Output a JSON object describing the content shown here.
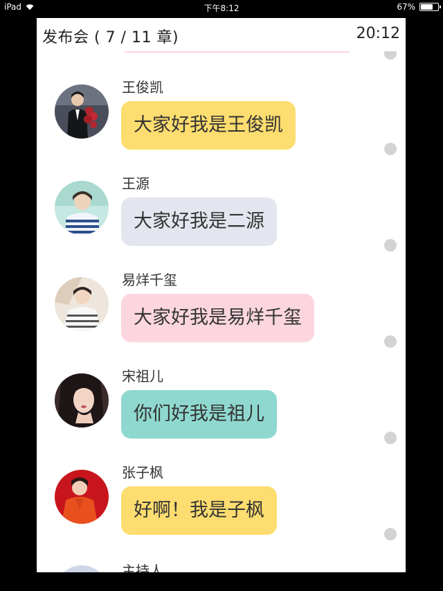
{
  "statusbar": {
    "device": "iPad",
    "time": "下午8:12",
    "battery": "67%",
    "battery_level": 0.67
  },
  "header": {
    "title": "发布会 ( 7 / 11 章)",
    "time": "20:12"
  },
  "colors": {
    "yellow": "#fddd6f",
    "grey": "#e3e6ee",
    "pink": "#fcd6de",
    "teal": "#8fd8cf",
    "dot": "#d3d3d3"
  },
  "messages": [
    {
      "sender": "王俊凯",
      "text": "大家好我是王俊凯",
      "bubble_color": "#fddd6f",
      "avatar": "avatar-wangjunkai"
    },
    {
      "sender": "王源",
      "text": "大家好我是二源",
      "bubble_color": "#e3e6ee",
      "avatar": "avatar-wangyuan"
    },
    {
      "sender": "易烊千玺",
      "text": "大家好我是易烊千玺",
      "bubble_color": "#fcd6de",
      "avatar": "avatar-yiyangqianxi"
    },
    {
      "sender": "宋祖儿",
      "text": "你们好我是祖儿",
      "bubble_color": "#8fd8cf",
      "avatar": "avatar-songzuer"
    },
    {
      "sender": "张子枫",
      "text": "好啊！我是子枫",
      "bubble_color": "#fddd6f",
      "avatar": "avatar-zhangzifeng"
    }
  ],
  "partial_message": {
    "sender": "主持人"
  }
}
